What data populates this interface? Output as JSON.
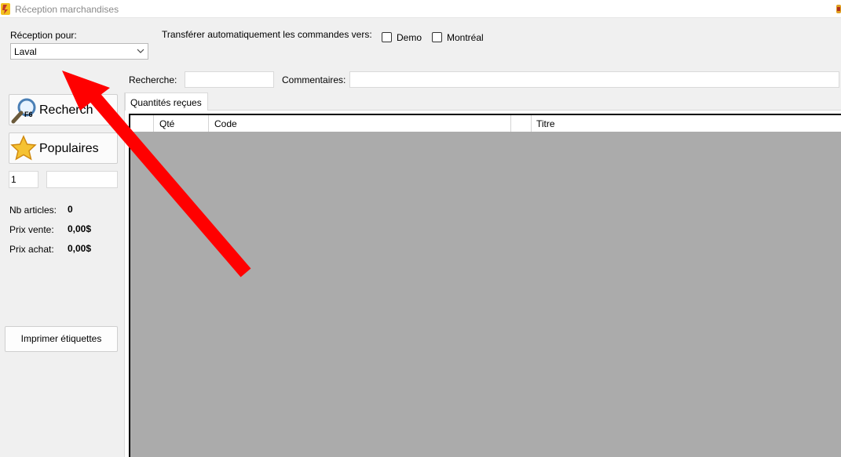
{
  "window": {
    "title": "Réception marchandises"
  },
  "reception": {
    "label": "Réception pour:",
    "selected": "Laval"
  },
  "transfer": {
    "label": "Transférer automatiquement les commandes vers:",
    "options": [
      {
        "label": "Demo",
        "checked": false
      },
      {
        "label": "Montréal",
        "checked": false
      }
    ]
  },
  "search": {
    "label": "Recherche:",
    "value": ""
  },
  "comments": {
    "label": "Commentaires:",
    "value": ""
  },
  "buttons": {
    "search_label": "Recherch",
    "search_shortcut": "F6",
    "popular_label": "Populaires",
    "print_labels": "Imprimer étiquettes"
  },
  "quantity": {
    "value": "1",
    "code": ""
  },
  "stats": {
    "nb_articles_label": "Nb articles:",
    "nb_articles_value": "0",
    "prix_vente_label": "Prix vente:",
    "prix_vente_value": "0,00$",
    "prix_achat_label": "Prix achat:",
    "prix_achat_value": "0,00$"
  },
  "tabs": [
    {
      "label": "Quantités reçues",
      "active": true
    }
  ],
  "grid": {
    "columns": [
      "",
      "Qté",
      "Code",
      "",
      "Titre"
    ],
    "rows": []
  },
  "annotation": {
    "arrow_color": "#ff0000",
    "icon": "red-arrow-annotation"
  }
}
